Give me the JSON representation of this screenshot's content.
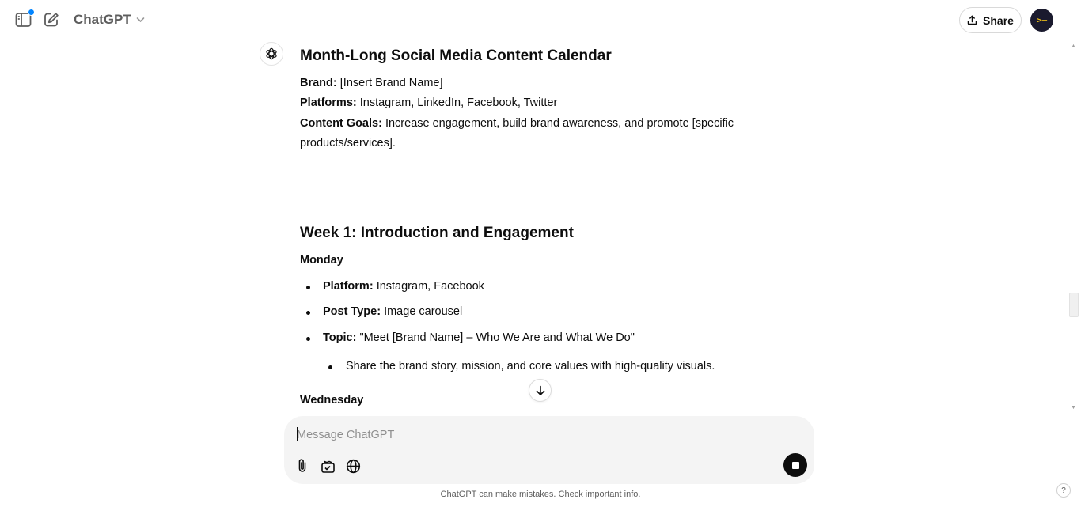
{
  "header": {
    "model_name": "ChatGPT",
    "share_label": "Share",
    "avatar_text": ">–"
  },
  "message": {
    "title": "Month-Long Social Media Content Calendar",
    "brand_label": "Brand:",
    "brand_value": "[Insert Brand Name]",
    "platforms_label": "Platforms:",
    "platforms_value": "Instagram, LinkedIn, Facebook, Twitter",
    "goals_label": "Content Goals:",
    "goals_value_line1": "Increase engagement, build brand awareness, and promote [specific",
    "goals_value_line2": "products/services].",
    "week1_title": "Week 1: Introduction and Engagement",
    "monday": "Monday",
    "monday_items": [
      {
        "label": "Platform:",
        "value": "Instagram, Facebook"
      },
      {
        "label": "Post Type:",
        "value": "Image carousel"
      },
      {
        "label": "Topic:",
        "value": "\"Meet [Brand Name] – Who We Are and What We Do\""
      }
    ],
    "monday_subitem": "Share the brand story, mission, and core values with high-quality visuals.",
    "wednesday": "Wednesday"
  },
  "composer": {
    "placeholder": "Message ChatGPT"
  },
  "footer": {
    "disclaimer": "ChatGPT can make mistakes. Check important info.",
    "help": "?"
  },
  "icons": {
    "sidebar": "sidebar-toggle-icon",
    "new_chat": "new-chat-icon",
    "chevron": "chevron-down-icon",
    "share": "share-icon",
    "attach": "paperclip-icon",
    "tools": "tools-icon",
    "web": "globe-icon",
    "stop": "stop-icon",
    "scroll_down": "arrow-down-icon",
    "assistant": "openai-logo-icon"
  },
  "colors": {
    "accent_dot": "#0285ff",
    "text": "#0d0d0d",
    "composer_bg": "#f4f4f4"
  }
}
